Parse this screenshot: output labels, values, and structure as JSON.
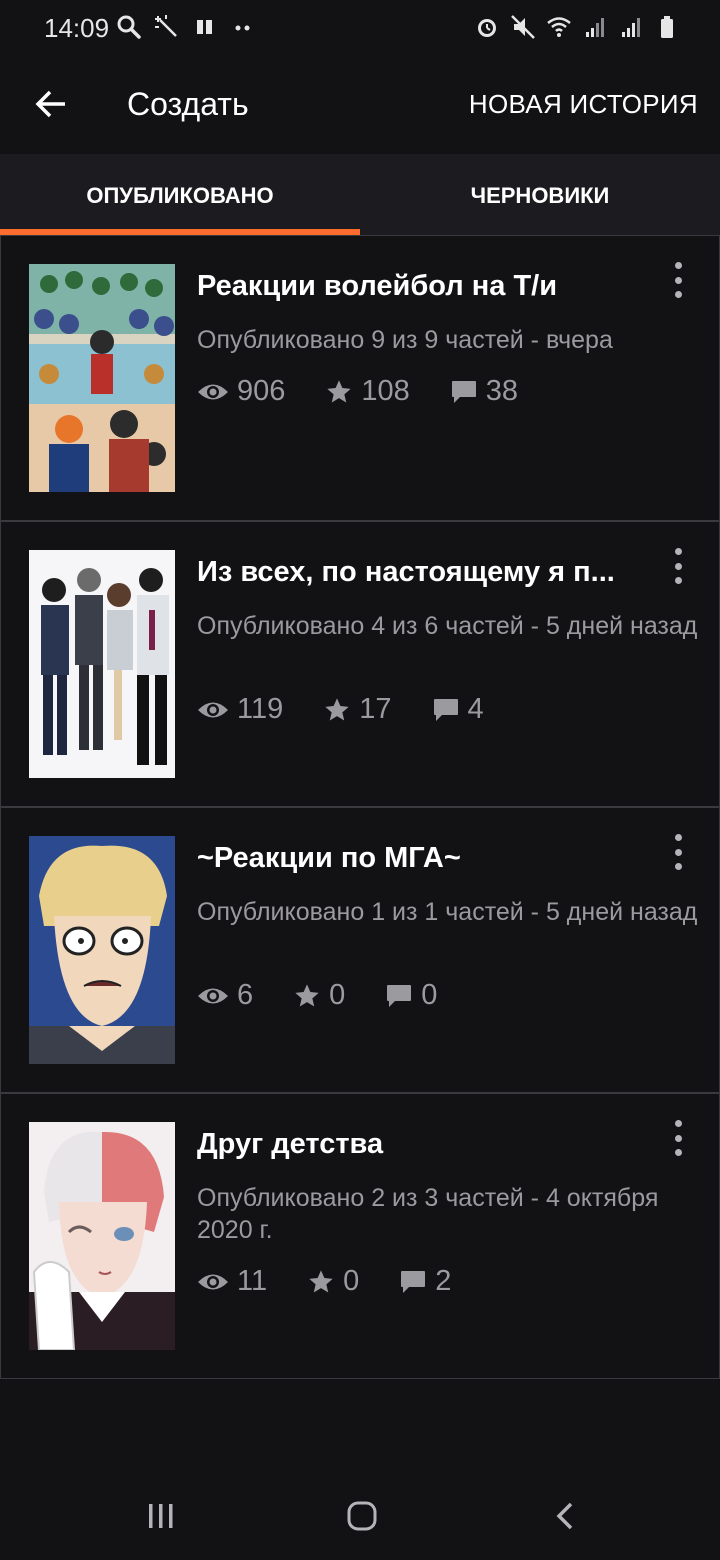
{
  "status_bar": {
    "time": "14:09",
    "left_icons": [
      "search-icon",
      "magic-wand-icon",
      "media-icon",
      "more-dots-icon"
    ],
    "right_icons": [
      "alarm-icon",
      "mute-icon",
      "wifi-icon",
      "signal-icon",
      "signal-icon",
      "battery-icon"
    ]
  },
  "app_bar": {
    "title": "Создать",
    "action_label": "НОВАЯ ИСТОРИЯ",
    "back_icon": "back-arrow-icon"
  },
  "tabs": [
    {
      "label": "ОПУБЛИКОВАНО",
      "selected": true
    },
    {
      "label": "ЧЕРНОВИКИ",
      "selected": false
    }
  ],
  "accent_color": "#ff6d2e",
  "stories": [
    {
      "title": "Реакции волейбол на Т/и",
      "meta": "Опубликовано 9 из 9 частей - вчера",
      "views": "906",
      "votes": "108",
      "comments": "38",
      "cover": "volleyball-cover"
    },
    {
      "title": "Из всех,  по настоящему я п...",
      "meta": "Опубликовано 4 из 6 частей - 5 дней назад",
      "views": "119",
      "votes": "17",
      "comments": "4",
      "cover": "group-cover"
    },
    {
      "title": "~Реакции по МГА~",
      "meta": "Опубликовано 1 из 1 частей - 5 дней назад",
      "views": "6",
      "votes": "0",
      "comments": "0",
      "cover": "blonde-character-cover"
    },
    {
      "title": "Друг детства",
      "meta": "Опубликовано 2 из 3 частей - 4 октября 2020 г.",
      "views": "11",
      "votes": "0",
      "comments": "2",
      "cover": "two-tone-hair-cover"
    }
  ],
  "nav_bar": {
    "icons": [
      "recent-apps-icon",
      "home-icon",
      "back-icon"
    ]
  }
}
